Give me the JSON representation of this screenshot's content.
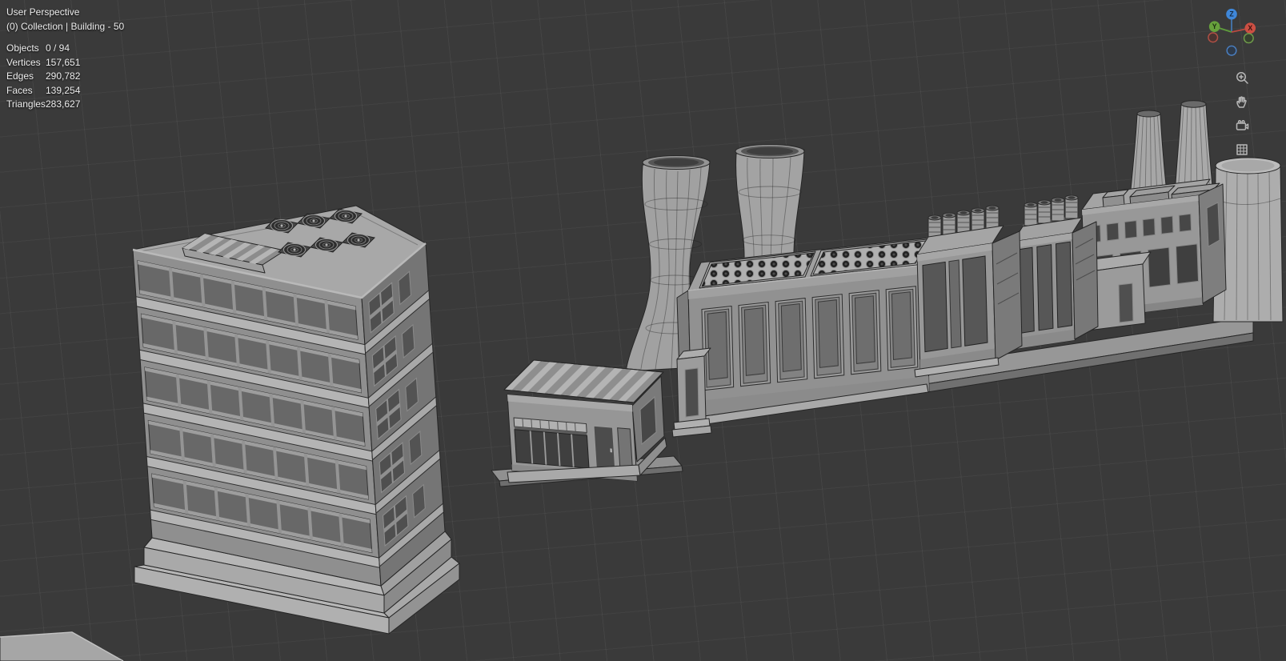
{
  "viewport": {
    "view_label": "User Perspective",
    "collection_label": "(0) Collection | Building - 50",
    "stats": [
      {
        "label": "Objects",
        "value": "0 / 94"
      },
      {
        "label": "Vertices",
        "value": "157,651"
      },
      {
        "label": "Edges",
        "value": "290,782"
      },
      {
        "label": "Faces",
        "value": "139,254"
      },
      {
        "label": "Triangles",
        "value": "283,627"
      }
    ],
    "gizmo": {
      "axis_labels": {
        "x": "X",
        "y": "Y",
        "z": "Z"
      }
    },
    "side_toolbar": [
      {
        "name": "zoom",
        "icon": "magnifier-plus-icon"
      },
      {
        "name": "move-view",
        "icon": "hand-icon"
      },
      {
        "name": "camera-view",
        "icon": "camera-icon"
      },
      {
        "name": "toggle-projection",
        "icon": "grid-icon"
      }
    ],
    "scene_objects": [
      "office-building",
      "shop-kiosk",
      "cooling-tower-left",
      "cooling-tower-right",
      "factory-hall",
      "vent-building-front",
      "vent-building-back",
      "power-station",
      "storage-tank",
      "ground-platform"
    ],
    "colors": {
      "background": "#3a3a3a",
      "grid_line": "#474747",
      "model_gray": "#9a9a9a",
      "edge_dark": "#262626",
      "axis_x": "#cc4f43",
      "axis_y": "#67a23c",
      "axis_z": "#3f87d9",
      "hud_text": "#ededed"
    }
  }
}
